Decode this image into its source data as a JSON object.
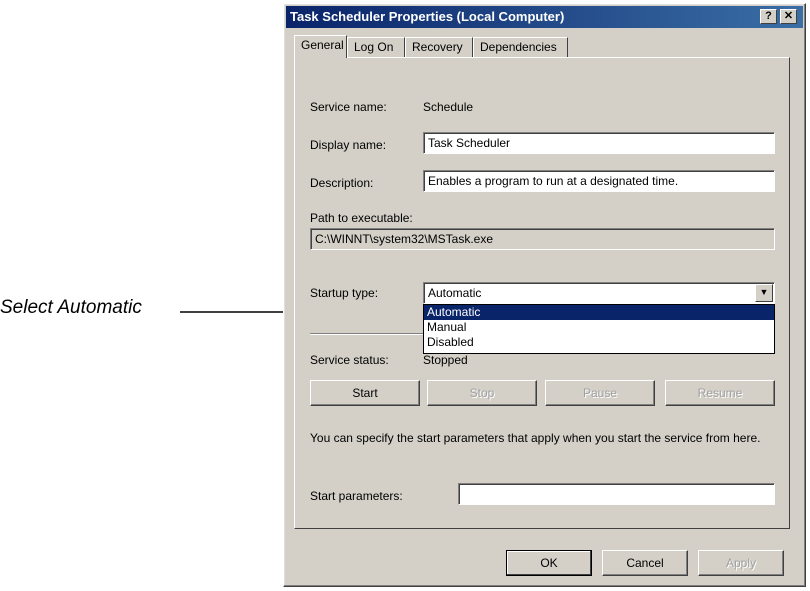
{
  "callout": {
    "text": "Select Automatic"
  },
  "window": {
    "title": "Task Scheduler Properties (Local Computer)",
    "help_label": "?",
    "close_label": "✕"
  },
  "tabs": [
    {
      "label": "General",
      "active": true
    },
    {
      "label": "Log On"
    },
    {
      "label": "Recovery"
    },
    {
      "label": "Dependencies"
    }
  ],
  "general": {
    "service_name_label": "Service name:",
    "service_name_value": "Schedule",
    "display_name_label": "Display name:",
    "display_name_value": "Task Scheduler",
    "description_label": "Description:",
    "description_value": "Enables a program to run at a designated time.",
    "path_label": "Path to executable:",
    "path_value": "C:\\WINNT\\system32\\MSTask.exe",
    "startup_type_label": "Startup type:",
    "startup_type_value": "Automatic",
    "startup_options": [
      "Automatic",
      "Manual",
      "Disabled"
    ],
    "service_status_label": "Service status:",
    "service_status_value": "Stopped",
    "buttons": {
      "start": "Start",
      "stop": "Stop",
      "pause": "Pause",
      "resume": "Resume"
    },
    "start_params_hint": "You can specify the start parameters that apply when you start the service from here.",
    "start_params_label": "Start parameters:",
    "start_params_value": ""
  },
  "footer": {
    "ok": "OK",
    "cancel": "Cancel",
    "apply": "Apply"
  },
  "colors": {
    "titlebar": "#0a246a",
    "face": "#d4d0c8",
    "selection": "#0a246a"
  }
}
